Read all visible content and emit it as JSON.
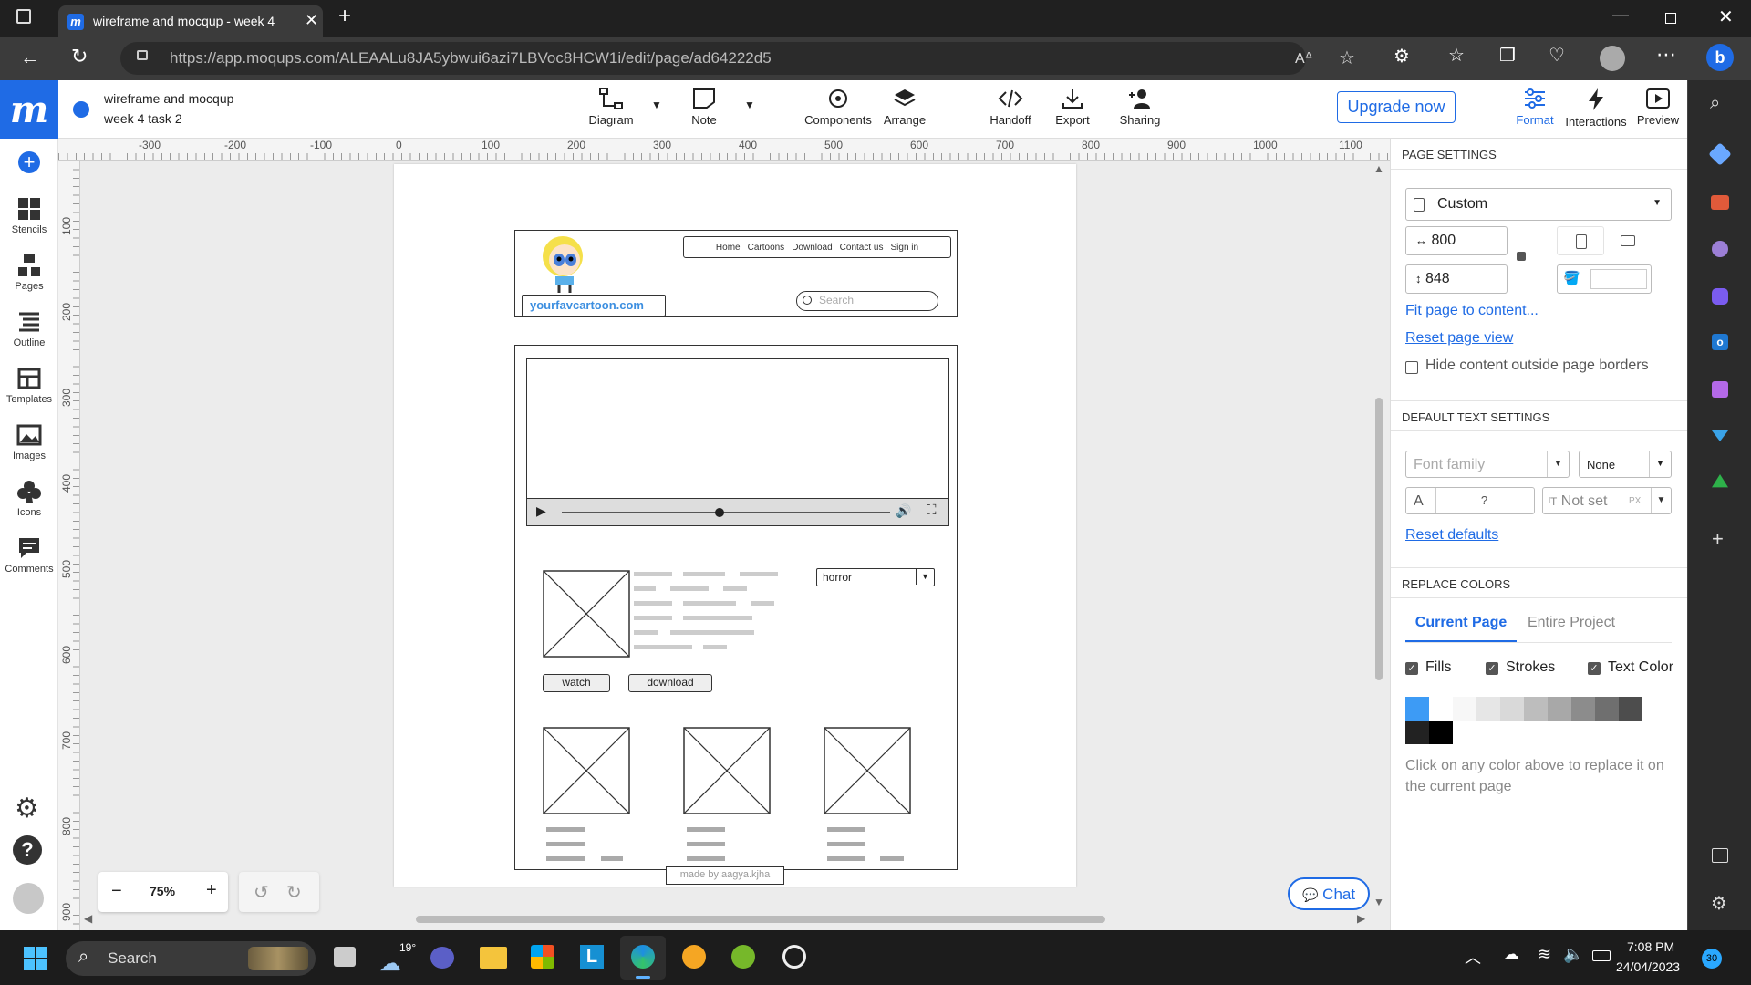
{
  "browser": {
    "tab_title": "wireframe and mocqup - week 4",
    "url": "https://app.moqups.com/ALEAALu8JA5ybwui6azi7LBVoc8HCW1i/edit/page/ad64222d5"
  },
  "app": {
    "project_title": "wireframe and mocqup",
    "page_title": "week 4 task 2",
    "toolbar": [
      "Diagram",
      "Note",
      "Components",
      "Arrange",
      "Handoff",
      "Export",
      "Sharing"
    ],
    "upgrade_label": "Upgrade now",
    "right_tabs": [
      "Format",
      "Interactions",
      "Preview"
    ],
    "accent_color": "#1f6be5"
  },
  "left_sidebar": [
    "Stencils",
    "Pages",
    "Outline",
    "Templates",
    "Images",
    "Icons",
    "Comments"
  ],
  "rulers": {
    "horizontal": [
      "-300",
      "-200",
      "-100",
      "0",
      "100",
      "200",
      "300",
      "400",
      "500",
      "600",
      "700",
      "800",
      "900",
      "1000",
      "1100"
    ],
    "vertical": [
      "100",
      "200",
      "300",
      "400",
      "500",
      "600",
      "700",
      "800",
      "900"
    ]
  },
  "wireframe": {
    "nav_links": [
      "Home",
      "Cartoons",
      "Download",
      "Contact us",
      "Sign in"
    ],
    "site_name": "yourfavcartoon.com",
    "search_placeholder": "Search",
    "genre_select": "horror",
    "watch_button": "watch",
    "download_button": "download",
    "footer": "made by:aagya.kjha"
  },
  "zoom": {
    "level": "75%",
    "minus": "−",
    "plus": "+"
  },
  "chat_label": "Chat",
  "page_settings": {
    "header": "PAGE SETTINGS",
    "preset": "Custom",
    "width": "800",
    "height": "848",
    "fit_link": "Fit page to content...",
    "reset_link": "Reset page view",
    "hide_label": "Hide content outside page borders"
  },
  "text_settings": {
    "header": "DEFAULT TEXT SETTINGS",
    "font_family_placeholder": "Font family",
    "style_value": "None",
    "size_label": "A",
    "size_value": "?",
    "line_height": "Not set",
    "line_unit": "PX",
    "reset_defaults": "Reset defaults"
  },
  "replace_colors": {
    "header": "REPLACE COLORS",
    "tabs": [
      "Current Page",
      "Entire Project"
    ],
    "checks": [
      "Fills",
      "Strokes",
      "Text Color"
    ],
    "swatches": [
      "#3d9bf5",
      "#ffffff",
      "#f7f7f7",
      "#e6e6e6",
      "#d9d9d9",
      "#bdbdbd",
      "#a8a8a8",
      "#8c8c8c",
      "#6f6f6f",
      "#4d4d4d",
      "#222222",
      "#000000"
    ],
    "hint": "Click on any color above to replace it on the current page"
  },
  "taskbar": {
    "search": "Search",
    "weather": "19°",
    "time": "7:08 PM",
    "date": "24/04/2023",
    "badge": "30"
  }
}
